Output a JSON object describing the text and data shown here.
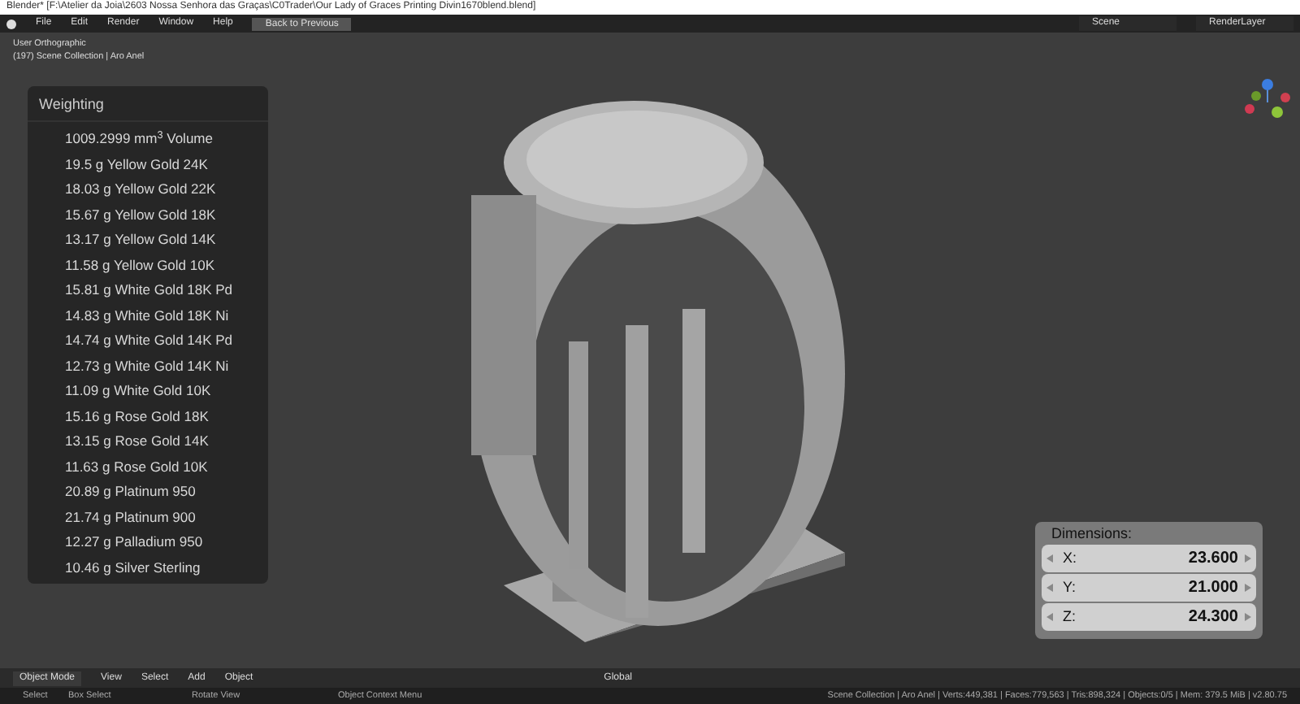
{
  "window": {
    "title": "Blender* [F:\\Atelier da Joia\\2603 Nossa Senhora das Graças\\C0Trader\\Our Lady of Graces Printing Divin1670blend.blend]"
  },
  "menu": [
    "File",
    "Edit",
    "Render",
    "Window",
    "Help"
  ],
  "back_button": "Back to Previous",
  "scene": "Scene",
  "render_layer": "RenderLayer",
  "viewport": {
    "info": [
      "User Orthographic",
      "(197) Scene Collection | Aro Anel"
    ]
  },
  "weighting": {
    "title": "Weighting",
    "rows": [
      {
        "value": "1009.2999 mm$^{3}$",
        "label": "Volume"
      },
      {
        "value": "19.5 g",
        "label": "Yellow Gold 24K"
      },
      {
        "value": "18.03 g",
        "label": "Yellow Gold 22K"
      },
      {
        "value": "15.67 g",
        "label": "Yellow Gold 18K"
      },
      {
        "value": "13.17 g",
        "label": "Yellow Gold 14K"
      },
      {
        "value": "11.58 g",
        "label": "Yellow Gold 10K"
      },
      {
        "value": "15.81 g",
        "label": "White Gold 18K Pd"
      },
      {
        "value": "14.83 g",
        "label": "White Gold 18K Ni"
      },
      {
        "value": "14.74 g",
        "label": "White Gold 14K Pd"
      },
      {
        "value": "12.73 g",
        "label": "White Gold 14K Ni"
      },
      {
        "value": "11.09 g",
        "label": "White Gold 10K"
      },
      {
        "value": "15.16 g",
        "label": "Rose Gold 18K"
      },
      {
        "value": "13.15 g",
        "label": "Rose Gold 14K"
      },
      {
        "value": "11.63 g",
        "label": "Rose Gold 10K"
      },
      {
        "value": "20.89 g",
        "label": "Platinum 950"
      },
      {
        "value": "21.74 g",
        "label": "Platinum 900"
      },
      {
        "value": "12.27 g",
        "label": "Palladium 950"
      },
      {
        "value": "10.46 g",
        "label": "Silver Sterling"
      }
    ]
  },
  "dimensions": {
    "title": "Dimensions:",
    "fields": [
      {
        "axis": "X:",
        "value": "23.600"
      },
      {
        "axis": "Y:",
        "value": "21.000"
      },
      {
        "axis": "Z:",
        "value": "24.300"
      }
    ]
  },
  "header": {
    "mode": "Object Mode",
    "menu": [
      "View",
      "Select",
      "Add",
      "Object"
    ],
    "orientation": "Global"
  },
  "status_bar": {
    "hints": [
      "Select",
      "Box Select",
      "Rotate View",
      "Object Context Menu"
    ],
    "stats": "Scene Collection | Aro Anel | Verts:449,381 | Faces:779,563 | Tris:898,324 | Objects:0/5 | Mem: 379.5 MiB | v2.80.75"
  }
}
